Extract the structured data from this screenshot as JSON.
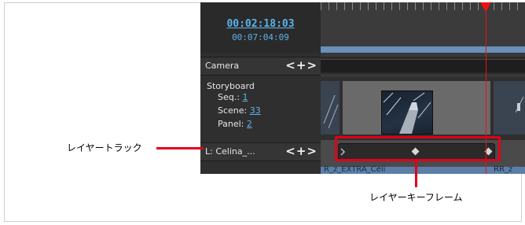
{
  "timecode": {
    "current": "00:02:18:03",
    "total": "00:07:04:09"
  },
  "camera_row": {
    "label": "Camera",
    "controls": "<+>"
  },
  "storyboard": {
    "title": "Storyboard",
    "seq_label": "Seq.:",
    "seq_value": "1",
    "scene_label": "Scene:",
    "scene_value": "33",
    "panel_label": "Panel:",
    "panel_value": "2"
  },
  "layer_row": {
    "label": "L: Celina_...",
    "controls": "<+>"
  },
  "bottom_strip": {
    "left_text": "R_z_EXTRA_Celi",
    "right_text": "RR_z"
  },
  "annotations": {
    "layer_track": "レイヤートラック",
    "layer_keyframe": "レイヤーキーフレーム"
  },
  "colors": {
    "accent": "#5ab4ea",
    "annotation_red": "#e2001a",
    "playhead": "#ee1111"
  }
}
